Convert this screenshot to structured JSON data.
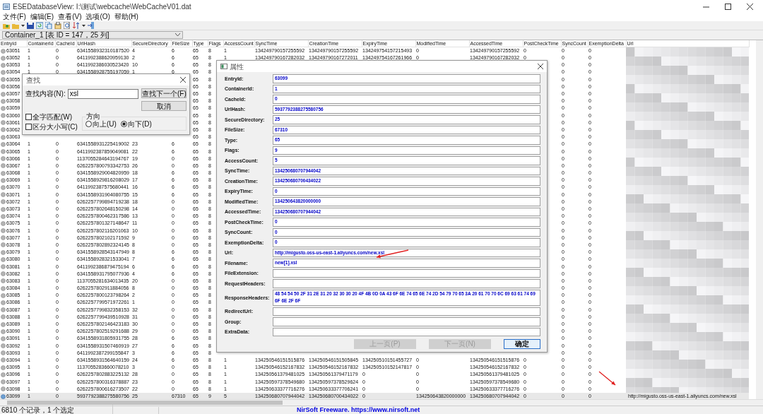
{
  "window": {
    "title": "ESEDatabaseView:   I:\\测试\\webcache\\WebCacheV01.dat"
  },
  "menu": [
    "文件(F)",
    "编辑(E)",
    "查看(V)",
    "选项(O)",
    "帮助(H)"
  ],
  "table_selector": {
    "value": "Container_1  [表 ID = 147，25 列]"
  },
  "table": {
    "columns": [
      "EntryId",
      "ContainerId",
      "CacheId",
      "UrlHash",
      "SecureDirectory",
      "FileSize",
      "Type",
      "Flags",
      "AccessCount",
      "SyncTime",
      "CreationTime",
      "ExpiryTime",
      "ModifiedTime",
      "AccessedTime",
      "PostCheckTime",
      "SyncCount",
      "ExemptionDelta",
      "Url"
    ],
    "rows": [
      {
        "selected": false,
        "cells": [
          "63051",
          "1",
          "0",
          "6341558932310187520",
          "4",
          "6",
          "65",
          "8",
          "1",
          "134249790157255592",
          "134249790157255592",
          "134249754157215493",
          "0",
          "134249790157255592",
          "0",
          "0",
          "0"
        ]
      },
      {
        "selected": false,
        "cells": [
          "63052",
          "1",
          "0",
          "6411992388620959130",
          "2",
          "6",
          "65",
          "8",
          "1",
          "134249790167282032",
          "134249790167272011",
          "134249754167261966",
          "0",
          "134249790167282032",
          "0",
          "0",
          "0"
        ]
      },
      {
        "selected": false,
        "cells": [
          "63053",
          "1",
          "0",
          "6411992386030523420",
          "10",
          "6",
          "65",
          "8",
          null,
          null,
          null,
          null,
          null,
          null,
          null,
          "0",
          "0"
        ]
      },
      {
        "selected": false,
        "cells": [
          "63054",
          "1",
          "0",
          "6341558928755197059",
          "1",
          "6",
          "65",
          "8",
          null,
          null,
          null,
          null,
          null,
          null,
          null,
          "0",
          "0"
        ]
      },
      {
        "selected": false,
        "cells": [
          "63055",
          null,
          null,
          null,
          null,
          null,
          "65",
          "8",
          null,
          null,
          null,
          null,
          null,
          null,
          null,
          "0",
          "0"
        ]
      },
      {
        "selected": false,
        "cells": [
          "63056",
          null,
          null,
          null,
          null,
          null,
          "65",
          "8",
          null,
          null,
          null,
          null,
          null,
          null,
          null,
          "0",
          "0"
        ]
      },
      {
        "selected": false,
        "cells": [
          "63057",
          null,
          null,
          null,
          null,
          null,
          "65",
          "8",
          null,
          null,
          null,
          null,
          null,
          null,
          null,
          "0",
          "0"
        ]
      },
      {
        "selected": false,
        "cells": [
          "63058",
          null,
          null,
          null,
          null,
          null,
          "65",
          "8",
          null,
          null,
          null,
          null,
          null,
          null,
          null,
          "0",
          "0"
        ]
      },
      {
        "selected": false,
        "cells": [
          "63059",
          null,
          null,
          null,
          null,
          null,
          "65",
          "8",
          null,
          null,
          null,
          null,
          null,
          null,
          null,
          "0",
          "0"
        ]
      },
      {
        "selected": false,
        "cells": [
          "63060",
          null,
          null,
          null,
          null,
          null,
          "65",
          "8",
          null,
          null,
          null,
          null,
          null,
          null,
          null,
          "0",
          "0"
        ]
      },
      {
        "selected": false,
        "cells": [
          "63061",
          null,
          null,
          null,
          null,
          null,
          "65",
          "8",
          null,
          null,
          null,
          null,
          null,
          null,
          null,
          "0",
          "0"
        ]
      },
      {
        "selected": false,
        "cells": [
          "63062",
          null,
          null,
          null,
          null,
          null,
          "65",
          "8",
          null,
          null,
          null,
          null,
          null,
          null,
          null,
          "0",
          "0"
        ]
      },
      {
        "selected": false,
        "cells": [
          "63063",
          null,
          null,
          null,
          null,
          null,
          "65",
          "8",
          null,
          null,
          null,
          null,
          null,
          null,
          null,
          "0",
          "0"
        ]
      },
      {
        "selected": false,
        "cells": [
          "63064",
          "1",
          "0",
          "6341558931225419002",
          "23",
          "6",
          "65",
          "8",
          null,
          null,
          null,
          null,
          null,
          null,
          null,
          "0",
          "0"
        ]
      },
      {
        "selected": false,
        "cells": [
          "63065",
          "1",
          "0",
          "6411992387859049081",
          "22",
          "6",
          "65",
          "8",
          null,
          null,
          null,
          null,
          null,
          null,
          null,
          "0",
          "0"
        ]
      },
      {
        "selected": false,
        "cells": [
          "63066",
          "1",
          "0",
          "1137055284643194767",
          "19",
          "0",
          "65",
          "8",
          null,
          null,
          null,
          null,
          null,
          null,
          null,
          "0",
          "0"
        ]
      },
      {
        "selected": false,
        "cells": [
          "63067",
          "1",
          "0",
          "6262257800793342753",
          "26",
          "0",
          "65",
          "8",
          null,
          null,
          null,
          null,
          null,
          null,
          null,
          "0",
          "0"
        ]
      },
      {
        "selected": false,
        "cells": [
          "63068",
          "1",
          "0",
          "6341558929004820959",
          "18",
          "6",
          "65",
          "8",
          null,
          null,
          null,
          null,
          null,
          null,
          null,
          "0",
          "0"
        ]
      },
      {
        "selected": false,
        "cells": [
          "63069",
          "1",
          "0",
          "6341558929816208029",
          "17",
          "6",
          "65",
          "8",
          null,
          null,
          null,
          null,
          null,
          null,
          null,
          "0",
          "0"
        ]
      },
      {
        "selected": false,
        "cells": [
          "63070",
          "1",
          "0",
          "6411992387575680441",
          "16",
          "6",
          "65",
          "8",
          null,
          null,
          null,
          null,
          null,
          null,
          null,
          "0",
          "0"
        ]
      },
      {
        "selected": false,
        "cells": [
          "63071",
          "1",
          "0",
          "6341558931904080755",
          "15",
          "6",
          "65",
          "8",
          null,
          null,
          null,
          null,
          null,
          null,
          null,
          "0",
          "0"
        ]
      },
      {
        "selected": false,
        "cells": [
          "63072",
          "1",
          "0",
          "6262257799894719238",
          "18",
          "0",
          "65",
          "8",
          null,
          null,
          null,
          null,
          null,
          null,
          null,
          "0",
          "0"
        ]
      },
      {
        "selected": false,
        "cells": [
          "63073",
          "1",
          "0",
          "6262257802648150298",
          "14",
          "0",
          "65",
          "8",
          null,
          null,
          null,
          null,
          null,
          null,
          null,
          "0",
          "0"
        ]
      },
      {
        "selected": false,
        "cells": [
          "63074",
          "1",
          "0",
          "6262257800462317586",
          "13",
          "0",
          "65",
          "8",
          null,
          null,
          null,
          null,
          null,
          null,
          null,
          "0",
          "0"
        ]
      },
      {
        "selected": false,
        "cells": [
          "63075",
          "1",
          "0",
          "6262257801327148647",
          "11",
          "0",
          "65",
          "8",
          null,
          null,
          null,
          null,
          null,
          null,
          null,
          "0",
          "0"
        ]
      },
      {
        "selected": false,
        "cells": [
          "63076",
          "1",
          "0",
          "6262257802116201063",
          "10",
          "0",
          "65",
          "8",
          null,
          null,
          null,
          null,
          null,
          null,
          null,
          "0",
          "0"
        ]
      },
      {
        "selected": false,
        "cells": [
          "63077",
          "1",
          "0",
          "6262257802102171592",
          "9",
          "0",
          "65",
          "8",
          null,
          null,
          null,
          null,
          null,
          null,
          null,
          "0",
          "0"
        ]
      },
      {
        "selected": false,
        "cells": [
          "63078",
          "1",
          "0",
          "6262257802892324145",
          "8",
          "0",
          "65",
          "8",
          null,
          null,
          null,
          null,
          null,
          null,
          null,
          "0",
          "0"
        ]
      },
      {
        "selected": false,
        "cells": [
          "63079",
          "1",
          "0",
          "6341558928543147949",
          "8",
          "6",
          "65",
          "8",
          null,
          null,
          null,
          null,
          null,
          null,
          null,
          "0",
          "0"
        ]
      },
      {
        "selected": false,
        "cells": [
          "63080",
          "1",
          "0",
          "6341558928321533041",
          "7",
          "6",
          "65",
          "8",
          null,
          null,
          null,
          null,
          null,
          null,
          null,
          "0",
          "0"
        ]
      },
      {
        "selected": false,
        "cells": [
          "63081",
          "1",
          "0",
          "6411992386879475194",
          "6",
          "6",
          "65",
          "8",
          null,
          null,
          null,
          null,
          null,
          null,
          null,
          "0",
          "0"
        ]
      },
      {
        "selected": false,
        "cells": [
          "63082",
          "1",
          "0",
          "6341558931795077936",
          "4",
          "6",
          "65",
          "8",
          null,
          null,
          null,
          null,
          null,
          null,
          null,
          "0",
          "0"
        ]
      },
      {
        "selected": false,
        "cells": [
          "63083",
          "1",
          "0",
          "1137055281634013435",
          "20",
          "0",
          "65",
          "8",
          null,
          null,
          null,
          null,
          null,
          null,
          null,
          "0",
          "0"
        ]
      },
      {
        "selected": false,
        "cells": [
          "63084",
          "1",
          "0",
          "6262257802911884056",
          "8",
          "0",
          "65",
          "8",
          null,
          null,
          null,
          null,
          null,
          null,
          null,
          "0",
          "0"
        ]
      },
      {
        "selected": false,
        "cells": [
          "63085",
          "1",
          "0",
          "6262257800123798264",
          "2",
          "0",
          "65",
          "8",
          null,
          null,
          null,
          null,
          null,
          null,
          null,
          "0",
          "0"
        ]
      },
      {
        "selected": false,
        "cells": [
          "63086",
          "1",
          "0",
          "6262257799571972261",
          "1",
          "0",
          "65",
          "8",
          null,
          null,
          null,
          null,
          null,
          null,
          null,
          "0",
          "0"
        ]
      },
      {
        "selected": false,
        "cells": [
          "63087",
          "1",
          "0",
          "6262257799832358153",
          "32",
          "0",
          "65",
          "8",
          null,
          null,
          null,
          null,
          null,
          null,
          null,
          "0",
          "0"
        ]
      },
      {
        "selected": false,
        "cells": [
          "63088",
          "1",
          "0",
          "6262257799439510928",
          "31",
          "0",
          "65",
          "8",
          null,
          null,
          null,
          null,
          null,
          null,
          null,
          "0",
          "0"
        ]
      },
      {
        "selected": false,
        "cells": [
          "63089",
          "1",
          "0",
          "6262257802146423183",
          "30",
          "0",
          "65",
          "8",
          null,
          null,
          null,
          null,
          null,
          null,
          null,
          "0",
          "0"
        ]
      },
      {
        "selected": false,
        "cells": [
          "63090",
          "1",
          "0",
          "6262257802519291688",
          "29",
          "0",
          "65",
          "8",
          null,
          null,
          null,
          null,
          null,
          null,
          null,
          "0",
          "0"
        ]
      },
      {
        "selected": false,
        "cells": [
          "63091",
          "1",
          "0",
          "6341558931805931755",
          "28",
          "6",
          "65",
          "8",
          null,
          null,
          null,
          null,
          null,
          null,
          null,
          "0",
          "0"
        ]
      },
      {
        "selected": false,
        "cells": [
          "63092",
          "1",
          "0",
          "6341558931507460919",
          "27",
          "6",
          "65",
          "8",
          null,
          null,
          null,
          null,
          null,
          null,
          null,
          "0",
          "0"
        ]
      },
      {
        "selected": false,
        "cells": [
          "63093",
          "1",
          "0",
          "6411992387299155847",
          "3",
          "6",
          "65",
          "8",
          null,
          null,
          null,
          null,
          null,
          null,
          null,
          "0",
          "0"
        ]
      },
      {
        "selected": false,
        "cells": [
          "63094",
          "1",
          "0",
          "6341558931564640159",
          "24",
          "6",
          "65",
          "8",
          "1",
          "134250546151515876",
          "134250546151505845",
          "134250510151455727",
          "0",
          "134250546151515876",
          "0",
          "0",
          "0"
        ]
      },
      {
        "selected": false,
        "cells": [
          "63095",
          "1",
          "0",
          "1137055283660078210",
          "3",
          "0",
          "65",
          "8",
          "1",
          "134250546152167832",
          "134250546152167832",
          "134250510152147817",
          "0",
          "134250546152167832",
          "0",
          "0",
          "0"
        ]
      },
      {
        "selected": false,
        "cells": [
          "63096",
          "1",
          "0",
          "6262257802883225132",
          "28",
          "0",
          "65",
          "8",
          "1",
          "134250561379481025",
          "134250561379471179",
          "0",
          "0",
          "134250561379481025",
          "0",
          "0",
          "0"
        ]
      },
      {
        "selected": false,
        "cells": [
          "63097",
          "1",
          "0",
          "6262257800316378887",
          "23",
          "0",
          "65",
          "8",
          "1",
          "134250597378549680",
          "134250597378529624",
          "0",
          "0",
          "134250597378549680",
          "0",
          "0",
          "0"
        ]
      },
      {
        "selected": false,
        "cells": [
          "63098",
          "1",
          "0",
          "6262257800616273507",
          "22",
          "0",
          "65",
          "8",
          "1",
          "134250633377716276",
          "134250633377706241",
          "0",
          "0",
          "134250633377716276",
          "0",
          "0",
          "0"
        ]
      },
      {
        "selected": true,
        "cells": [
          "63099",
          "1",
          "0",
          "5937792388275580756",
          "25",
          "67310",
          "65",
          "9",
          "5",
          "134250680707944042",
          "134250680700434022",
          "0",
          "134250643820000000",
          "134250680707944042",
          "0",
          "0",
          "0"
        ],
        "url": "http://migusto.oss-us-east-1.aliyuncs.com/new.xsl"
      }
    ]
  },
  "find_dialog": {
    "title": "查找",
    "find_label": "查找内容(N):",
    "find_value": "xsl",
    "buttons": [
      {
        "label": "查找下一个(F)"
      },
      {
        "label": "取消"
      }
    ],
    "options": [
      {
        "label": "全字匹配(W)",
        "checked": false
      },
      {
        "label": "区分大小写(C)",
        "checked": false
      }
    ],
    "direction": {
      "label": "方向",
      "options": [
        {
          "label": "向上(U)",
          "selected": false
        },
        {
          "label": "向下(D)",
          "selected": true
        }
      ]
    }
  },
  "properties_dialog": {
    "title": "属性",
    "fields": [
      {
        "label": "EntryId:",
        "value": "63099"
      },
      {
        "label": "ContainerId:",
        "value": "1"
      },
      {
        "label": "CacheId:",
        "value": "0"
      },
      {
        "label": "UrlHash:",
        "value": "5937792388275580756"
      },
      {
        "label": "SecureDirectory:",
        "value": "25"
      },
      {
        "label": "FileSize:",
        "value": "67310"
      },
      {
        "label": "Type:",
        "value": "65"
      },
      {
        "label": "Flags:",
        "value": "9"
      },
      {
        "label": "AccessCount:",
        "value": "5"
      },
      {
        "label": "SyncTime:",
        "value": "134250680707944042"
      },
      {
        "label": "CreationTime:",
        "value": "134250680700434022"
      },
      {
        "label": "ExpiryTime:",
        "value": "0"
      },
      {
        "label": "ModifiedTime:",
        "value": "134250643820000000"
      },
      {
        "label": "AccessedTime:",
        "value": "134250680707944042"
      },
      {
        "label": "PostCheckTime:",
        "value": "0"
      },
      {
        "label": "SyncCount:",
        "value": "0"
      },
      {
        "label": "ExemptionDelta:",
        "value": "0"
      },
      {
        "label": "Url:",
        "value": "http://migusto.oss-us-east-1.aliyuncs.com/new.xsl"
      },
      {
        "label": "Filename:",
        "value": "new[1].xsl"
      },
      {
        "label": "FileExtension:"
      },
      {
        "label": "RequestHeaders:"
      },
      {
        "label": "ResponseHeaders:",
        "value": "48 54 54 50 2F 31 2E 31 20 32 30 30 20 4F 4B 0D 0A 43 6F 6E 74 65 6E 74 2D 54 79 70 65 3A 20 61 70 70 6C 69 63 61 74 69 6F 6E 2F 6F"
      },
      {
        "label": "RedirectUrl:"
      },
      {
        "label": "Group:"
      },
      {
        "label": "ExtraData:"
      }
    ],
    "buttons": [
      {
        "label": "上一页(P)",
        "disabled": true,
        "default": false
      },
      {
        "label": "下一页(N)",
        "disabled": true,
        "default": false
      },
      {
        "label": "确定",
        "disabled": false,
        "default": true
      }
    ]
  },
  "status_bar": {
    "count": "6810 个记录，1 个选定",
    "credit": "NirSoft Freeware.  https://www.nirsoft.net"
  }
}
